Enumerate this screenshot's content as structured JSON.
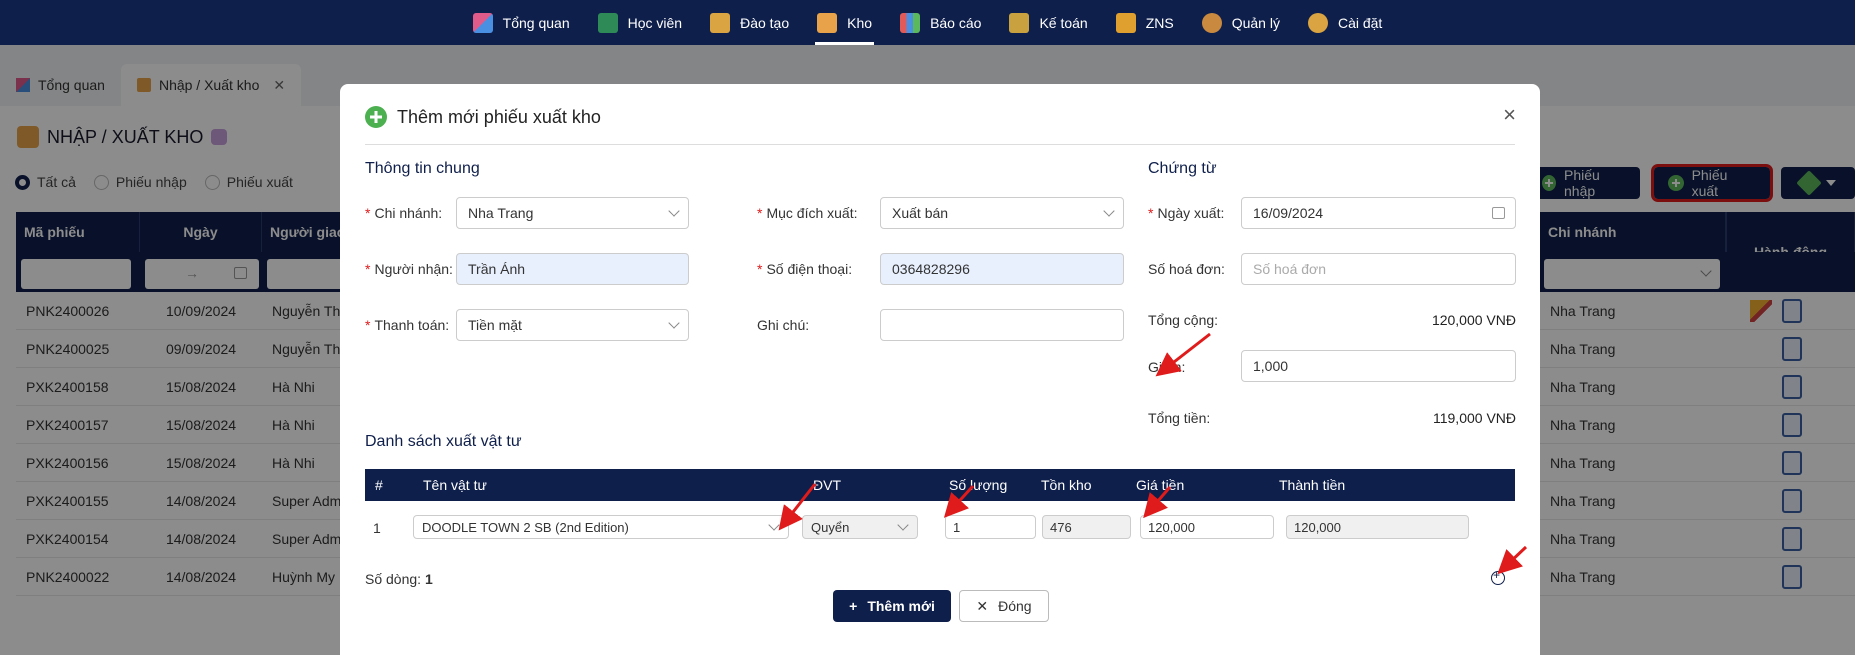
{
  "nav": {
    "items": [
      {
        "label": "Tổng quan",
        "icon": "dashboard-icon"
      },
      {
        "label": "Học viên",
        "icon": "student-icon"
      },
      {
        "label": "Đào tạo",
        "icon": "training-icon"
      },
      {
        "label": "Kho",
        "icon": "warehouse-icon"
      },
      {
        "label": "Báo cáo",
        "icon": "report-icon"
      },
      {
        "label": "Kế toán",
        "icon": "accounting-icon"
      },
      {
        "label": "ZNS",
        "icon": "zns-icon"
      },
      {
        "label": "Quản lý",
        "icon": "manage-icon"
      },
      {
        "label": "Cài đặt",
        "icon": "settings-gear-icon"
      }
    ],
    "active": "Kho"
  },
  "tabs": [
    {
      "label": "Tổng quan"
    },
    {
      "label": "Nhập / Xuất kho",
      "close": "✕"
    }
  ],
  "page": {
    "title": "NHẬP / XUẤT KHO",
    "filters": [
      "Tất cả",
      "Phiếu nhập",
      "Phiếu xuất"
    ],
    "buttons": {
      "import": "Phiếu nhập",
      "export": "Phiếu xuất"
    },
    "table": {
      "headers": {
        "code": "Mã phiếu",
        "date": "Ngày",
        "sender": "Người giao",
        "branch": "Chi nhánh",
        "actions": "Hành động"
      },
      "date_filter_arrow": "→",
      "rows": [
        {
          "code": "PNK2400026",
          "date": "10/09/2024",
          "sender": "Nguyễn Tha",
          "branch": "Nha Trang",
          "editable": true
        },
        {
          "code": "PNK2400025",
          "date": "09/09/2024",
          "sender": "Nguyễn Tha",
          "branch": "Nha Trang",
          "editable": false
        },
        {
          "code": "PXK2400158",
          "date": "15/08/2024",
          "sender": "Hà Nhi",
          "branch": "Nha Trang",
          "editable": false
        },
        {
          "code": "PXK2400157",
          "date": "15/08/2024",
          "sender": "Hà Nhi",
          "branch": "Nha Trang",
          "editable": false
        },
        {
          "code": "PXK2400156",
          "date": "15/08/2024",
          "sender": "Hà Nhi",
          "branch": "Nha Trang",
          "editable": false
        },
        {
          "code": "PXK2400155",
          "date": "14/08/2024",
          "sender": "Super Admi",
          "branch": "Nha Trang",
          "editable": false
        },
        {
          "code": "PXK2400154",
          "date": "14/08/2024",
          "sender": "Super Admi",
          "branch": "Nha Trang",
          "editable": false
        },
        {
          "code": "PNK2400022",
          "date": "14/08/2024",
          "sender": "Huỳnh My",
          "branch": "Nha Trang",
          "editable": false
        }
      ]
    }
  },
  "modal": {
    "title": "Thêm mới phiếu xuất kho",
    "close": "×",
    "general": {
      "heading": "Thông tin chung",
      "branch_label": "Chi nhánh",
      "branch_value": "Nha Trang",
      "purpose_label": "Mục đích xuất",
      "purpose_value": "Xuất bán",
      "receiver_label": "Người nhận",
      "receiver_value": "Trần Ánh",
      "phone_label": "Số điện thoại",
      "phone_value": "0364828296",
      "payment_label": "Thanh toán",
      "payment_value": "Tiền mặt",
      "note_label": "Ghi chú",
      "note_value": ""
    },
    "voucher": {
      "heading": "Chứng từ",
      "date_label": "Ngày xuất",
      "date_value": "16/09/2024",
      "invoice_label": "Số hoá đơn",
      "invoice_placeholder": "Số hoá đơn",
      "total_label": "Tổng cộng:",
      "total_value": "120,000 VNĐ",
      "discount_label": "Giảm",
      "discount_value": "1,000",
      "grand_label": "Tổng tiền:",
      "grand_value": "119,000 VNĐ"
    },
    "items": {
      "heading": "Danh sách xuất vật tư",
      "headers": {
        "no": "#",
        "name": "Tên vật tư",
        "unit": "ĐVT",
        "qty": "Số lượng",
        "stock": "Tồn kho",
        "price": "Giá tiền",
        "amount": "Thành tiền"
      },
      "rows": [
        {
          "no": "1",
          "name": "DOODLE TOWN 2 SB (2nd Edition)",
          "unit": "Quyển",
          "qty": "1",
          "stock": "476",
          "price": "120,000",
          "amount": "120,000"
        }
      ],
      "count_label": "Số dòng:",
      "count_value": "1"
    },
    "buttons": {
      "add": "Thêm mới",
      "close": "Đóng"
    }
  },
  "colors": {
    "navy": "#0f1f4b",
    "accent_green": "#4caf50",
    "annotation_red": "#e01b1b"
  }
}
